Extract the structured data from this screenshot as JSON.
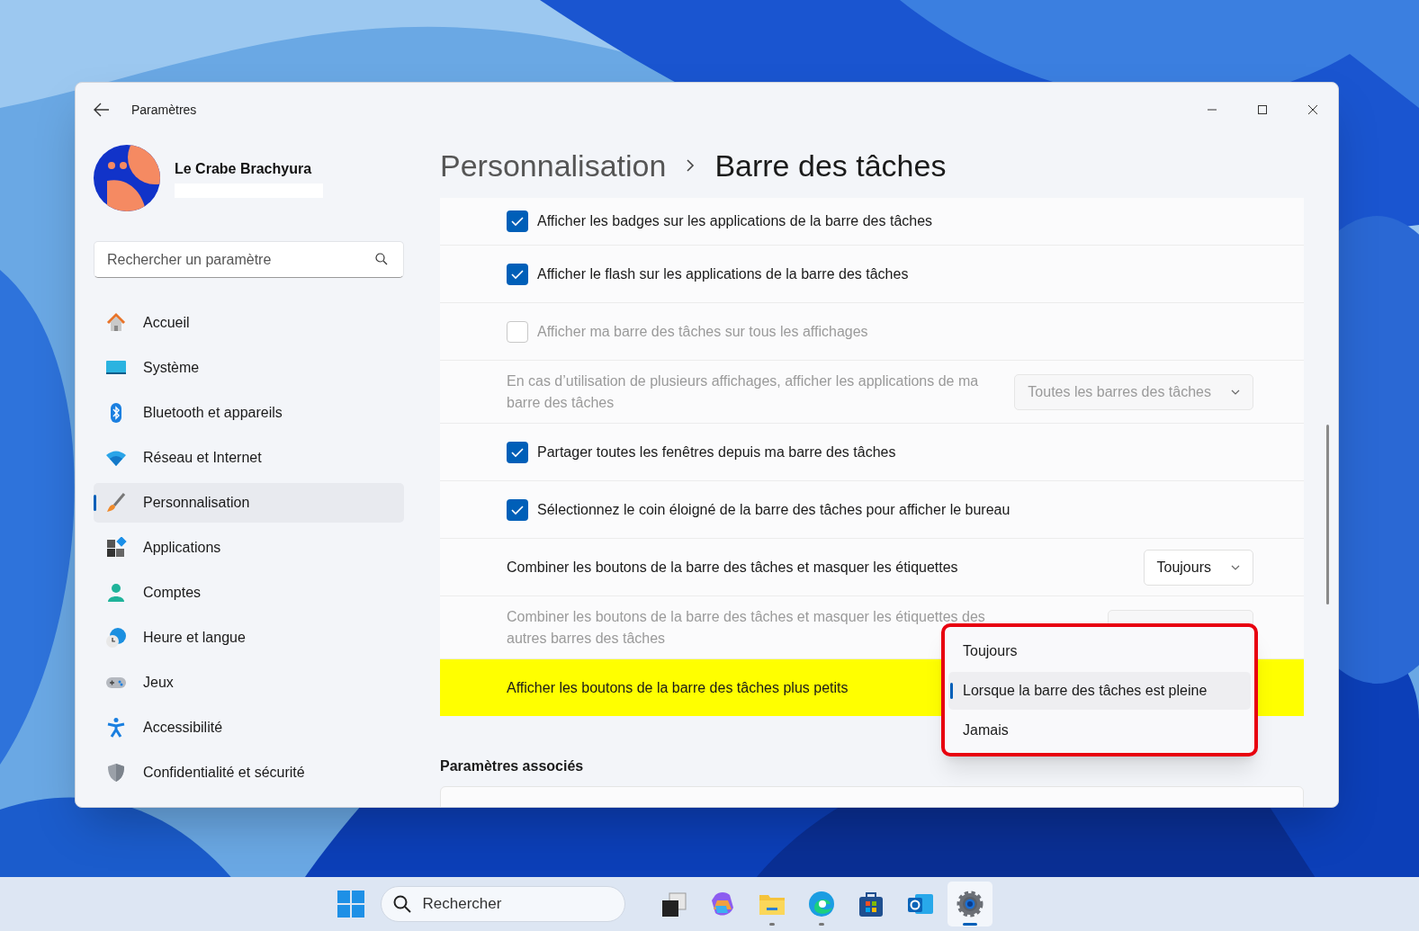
{
  "window": {
    "title": "Paramètres"
  },
  "user": {
    "name": "Le Crabe Brachyura"
  },
  "search": {
    "placeholder": "Rechercher un paramètre"
  },
  "nav": [
    {
      "label": "Accueil",
      "selected": false
    },
    {
      "label": "Système",
      "selected": false
    },
    {
      "label": "Bluetooth et appareils",
      "selected": false
    },
    {
      "label": "Réseau et Internet",
      "selected": false
    },
    {
      "label": "Personnalisation",
      "selected": true
    },
    {
      "label": "Applications",
      "selected": false
    },
    {
      "label": "Comptes",
      "selected": false
    },
    {
      "label": "Heure et langue",
      "selected": false
    },
    {
      "label": "Jeux",
      "selected": false
    },
    {
      "label": "Accessibilité",
      "selected": false
    },
    {
      "label": "Confidentialité et sécurité",
      "selected": false
    }
  ],
  "breadcrumb": [
    "Personnalisation",
    "Barre des tâches"
  ],
  "rows": [
    {
      "kind": "checkbox",
      "label": "Afficher les badges sur les applications de la barre des tâches",
      "checked": true,
      "disabled": false,
      "highlighted": false
    },
    {
      "kind": "checkbox",
      "label": "Afficher le flash sur les applications de la barre des tâches",
      "checked": true,
      "disabled": false,
      "highlighted": false
    },
    {
      "kind": "checkbox",
      "label": "Afficher ma barre des tâches sur tous les affichages",
      "checked": false,
      "disabled": true,
      "highlighted": false
    },
    {
      "kind": "dropdown",
      "label": "En cas d’utilisation de plusieurs affichages, afficher les applications de ma barre des tâches",
      "value": "Toutes les barres des tâches",
      "disabled": true,
      "highlighted": false
    },
    {
      "kind": "checkbox",
      "label": "Partager toutes les fenêtres depuis ma barre des tâches",
      "checked": true,
      "disabled": false,
      "highlighted": false
    },
    {
      "kind": "checkbox",
      "label": "Sélectionnez le coin éloigné de la barre des tâches pour afficher le bureau",
      "checked": true,
      "disabled": false,
      "highlighted": false
    },
    {
      "kind": "dropdown",
      "label": "Combiner les boutons de la barre des tâches et masquer les étiquettes",
      "value": "Toujours",
      "disabled": false,
      "highlighted": false
    },
    {
      "kind": "dropdown",
      "label": "Combiner les boutons de la barre des tâches et masquer les étiquettes des autres barres des tâches",
      "disabled": true,
      "highlighted": false
    },
    {
      "kind": "text",
      "label": "Afficher les boutons de la barre des tâches plus petits",
      "disabled": false,
      "highlighted": true
    }
  ],
  "popup": {
    "highlighted": true,
    "options": [
      {
        "label": "Toujours",
        "selected": false
      },
      {
        "label": "Lorsque la barre des tâches est pleine",
        "selected": true
      },
      {
        "label": "Jamais",
        "selected": false
      }
    ]
  },
  "related": {
    "title": "Paramètres associés"
  },
  "taskbar": {
    "search_placeholder": "Rechercher",
    "apps": [
      {
        "running": false,
        "active": false
      },
      {
        "running": false,
        "active": false
      },
      {
        "running": true,
        "active": false
      },
      {
        "running": true,
        "active": false
      },
      {
        "running": false,
        "active": false
      },
      {
        "running": false,
        "active": false
      },
      {
        "running": true,
        "active": true
      }
    ]
  }
}
